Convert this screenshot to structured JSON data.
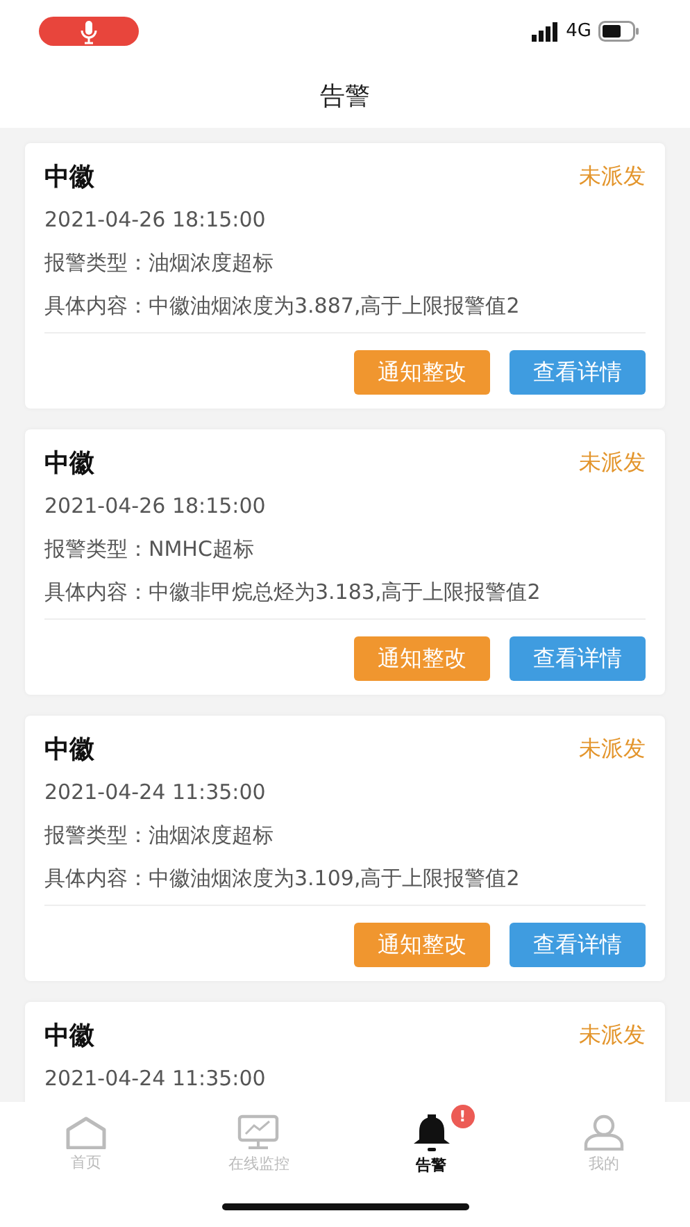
{
  "status_bar": {
    "network": "4G"
  },
  "header": {
    "title": "告警"
  },
  "alerts": [
    {
      "name": "中徽",
      "status": "未派发",
      "time": "2021-04-26 18:15:00",
      "type": "报警类型：油烟浓度超标",
      "content": "具体内容：中徽油烟浓度为3.887,高于上限报警值2",
      "buttons": [
        "通知整改",
        "查看详情"
      ]
    },
    {
      "name": "中徽",
      "status": "未派发",
      "time": "2021-04-26 18:15:00",
      "type": "报警类型：NMHC超标",
      "content": "具体内容：中徽非甲烷总烃为3.183,高于上限报警值2",
      "buttons": [
        "通知整改",
        "查看详情"
      ]
    },
    {
      "name": "中徽",
      "status": "未派发",
      "time": "2021-04-24 11:35:00",
      "type": "报警类型：油烟浓度超标",
      "content": "具体内容：中徽油烟浓度为3.109,高于上限报警值2",
      "buttons": [
        "通知整改",
        "查看详情"
      ]
    },
    {
      "name": "中徽",
      "status": "未派发",
      "time": "2021-04-24 11:35:00"
    }
  ],
  "tabs": [
    {
      "kind": "home",
      "label": "首页",
      "selected": false
    },
    {
      "kind": "monitor",
      "label": "在线监控",
      "selected": false
    },
    {
      "kind": "alarm",
      "label": "告警",
      "selected": true,
      "badge": "!"
    },
    {
      "kind": "user",
      "label": "我的",
      "selected": false
    }
  ]
}
